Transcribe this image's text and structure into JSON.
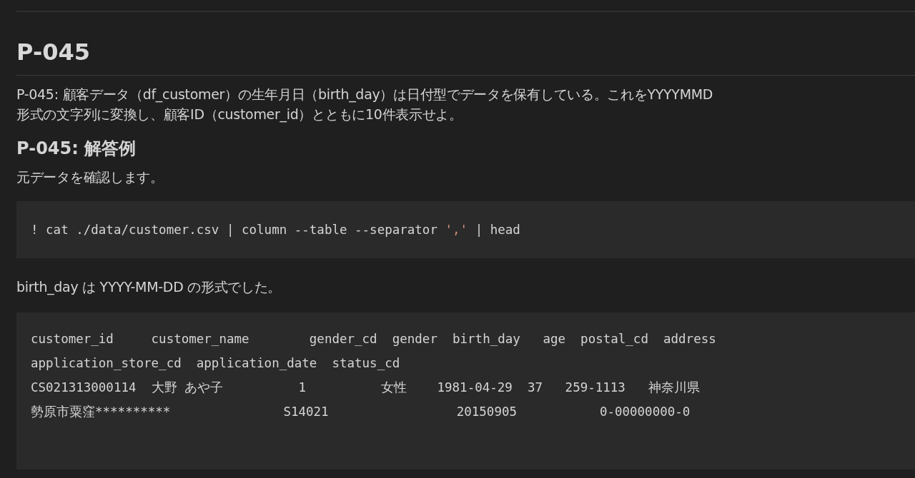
{
  "heading": "P-045",
  "question": "P-045: 顧客データ（df_customer）の生年月日（birth_day）は日付型でデータを保有している。これをYYYYMMD",
  "question_cont": "形式の文字列に変換し、顧客ID（customer_id）とともに10件表示せよ。",
  "subheading": "P-045: 解答例",
  "intro": "元データを確認します。",
  "code": [
    {
      "kind": "plain",
      "text": "! cat ./data/customer.csv | column --table --separator "
    },
    {
      "kind": "string",
      "text": "','"
    },
    {
      "kind": "plain",
      "text": " | head"
    }
  ],
  "note": "birth_day は YYYY-MM-DD の形式でした。",
  "output": [
    "customer_id     customer_name        gender_cd  gender  birth_day   age  postal_cd  address",
    "application_store_cd  application_date  status_cd",
    "CS021313000114  大野 あや子          1          女性    1981-04-29  37   259-1113   神奈川県",
    "勢原市粟窪**********               S14021                 20150905           0-00000000-0"
  ]
}
